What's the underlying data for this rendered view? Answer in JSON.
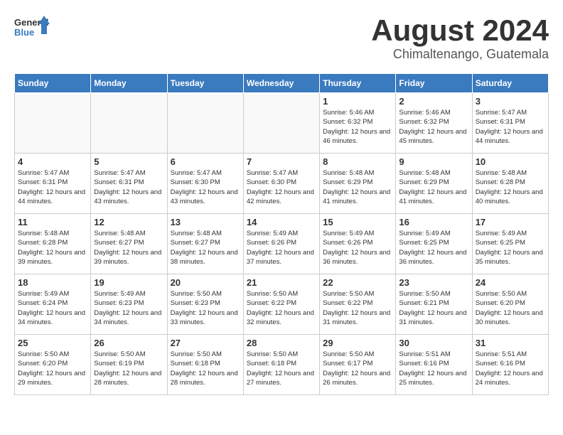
{
  "header": {
    "logo_general": "General",
    "logo_blue": "Blue",
    "month_year": "August 2024",
    "location": "Chimaltenango, Guatemala"
  },
  "weekdays": [
    "Sunday",
    "Monday",
    "Tuesday",
    "Wednesday",
    "Thursday",
    "Friday",
    "Saturday"
  ],
  "weeks": [
    [
      {
        "day": "",
        "info": ""
      },
      {
        "day": "",
        "info": ""
      },
      {
        "day": "",
        "info": ""
      },
      {
        "day": "",
        "info": ""
      },
      {
        "day": "1",
        "info": "Sunrise: 5:46 AM\nSunset: 6:32 PM\nDaylight: 12 hours\nand 46 minutes."
      },
      {
        "day": "2",
        "info": "Sunrise: 5:46 AM\nSunset: 6:32 PM\nDaylight: 12 hours\nand 45 minutes."
      },
      {
        "day": "3",
        "info": "Sunrise: 5:47 AM\nSunset: 6:31 PM\nDaylight: 12 hours\nand 44 minutes."
      }
    ],
    [
      {
        "day": "4",
        "info": "Sunrise: 5:47 AM\nSunset: 6:31 PM\nDaylight: 12 hours\nand 44 minutes."
      },
      {
        "day": "5",
        "info": "Sunrise: 5:47 AM\nSunset: 6:31 PM\nDaylight: 12 hours\nand 43 minutes."
      },
      {
        "day": "6",
        "info": "Sunrise: 5:47 AM\nSunset: 6:30 PM\nDaylight: 12 hours\nand 43 minutes."
      },
      {
        "day": "7",
        "info": "Sunrise: 5:47 AM\nSunset: 6:30 PM\nDaylight: 12 hours\nand 42 minutes."
      },
      {
        "day": "8",
        "info": "Sunrise: 5:48 AM\nSunset: 6:29 PM\nDaylight: 12 hours\nand 41 minutes."
      },
      {
        "day": "9",
        "info": "Sunrise: 5:48 AM\nSunset: 6:29 PM\nDaylight: 12 hours\nand 41 minutes."
      },
      {
        "day": "10",
        "info": "Sunrise: 5:48 AM\nSunset: 6:28 PM\nDaylight: 12 hours\nand 40 minutes."
      }
    ],
    [
      {
        "day": "11",
        "info": "Sunrise: 5:48 AM\nSunset: 6:28 PM\nDaylight: 12 hours\nand 39 minutes."
      },
      {
        "day": "12",
        "info": "Sunrise: 5:48 AM\nSunset: 6:27 PM\nDaylight: 12 hours\nand 39 minutes."
      },
      {
        "day": "13",
        "info": "Sunrise: 5:48 AM\nSunset: 6:27 PM\nDaylight: 12 hours\nand 38 minutes."
      },
      {
        "day": "14",
        "info": "Sunrise: 5:49 AM\nSunset: 6:26 PM\nDaylight: 12 hours\nand 37 minutes."
      },
      {
        "day": "15",
        "info": "Sunrise: 5:49 AM\nSunset: 6:26 PM\nDaylight: 12 hours\nand 36 minutes."
      },
      {
        "day": "16",
        "info": "Sunrise: 5:49 AM\nSunset: 6:25 PM\nDaylight: 12 hours\nand 36 minutes."
      },
      {
        "day": "17",
        "info": "Sunrise: 5:49 AM\nSunset: 6:25 PM\nDaylight: 12 hours\nand 35 minutes."
      }
    ],
    [
      {
        "day": "18",
        "info": "Sunrise: 5:49 AM\nSunset: 6:24 PM\nDaylight: 12 hours\nand 34 minutes."
      },
      {
        "day": "19",
        "info": "Sunrise: 5:49 AM\nSunset: 6:23 PM\nDaylight: 12 hours\nand 34 minutes."
      },
      {
        "day": "20",
        "info": "Sunrise: 5:50 AM\nSunset: 6:23 PM\nDaylight: 12 hours\nand 33 minutes."
      },
      {
        "day": "21",
        "info": "Sunrise: 5:50 AM\nSunset: 6:22 PM\nDaylight: 12 hours\nand 32 minutes."
      },
      {
        "day": "22",
        "info": "Sunrise: 5:50 AM\nSunset: 6:22 PM\nDaylight: 12 hours\nand 31 minutes."
      },
      {
        "day": "23",
        "info": "Sunrise: 5:50 AM\nSunset: 6:21 PM\nDaylight: 12 hours\nand 31 minutes."
      },
      {
        "day": "24",
        "info": "Sunrise: 5:50 AM\nSunset: 6:20 PM\nDaylight: 12 hours\nand 30 minutes."
      }
    ],
    [
      {
        "day": "25",
        "info": "Sunrise: 5:50 AM\nSunset: 6:20 PM\nDaylight: 12 hours\nand 29 minutes."
      },
      {
        "day": "26",
        "info": "Sunrise: 5:50 AM\nSunset: 6:19 PM\nDaylight: 12 hours\nand 28 minutes."
      },
      {
        "day": "27",
        "info": "Sunrise: 5:50 AM\nSunset: 6:18 PM\nDaylight: 12 hours\nand 28 minutes."
      },
      {
        "day": "28",
        "info": "Sunrise: 5:50 AM\nSunset: 6:18 PM\nDaylight: 12 hours\nand 27 minutes."
      },
      {
        "day": "29",
        "info": "Sunrise: 5:50 AM\nSunset: 6:17 PM\nDaylight: 12 hours\nand 26 minutes."
      },
      {
        "day": "30",
        "info": "Sunrise: 5:51 AM\nSunset: 6:16 PM\nDaylight: 12 hours\nand 25 minutes."
      },
      {
        "day": "31",
        "info": "Sunrise: 5:51 AM\nSunset: 6:16 PM\nDaylight: 12 hours\nand 24 minutes."
      }
    ]
  ]
}
